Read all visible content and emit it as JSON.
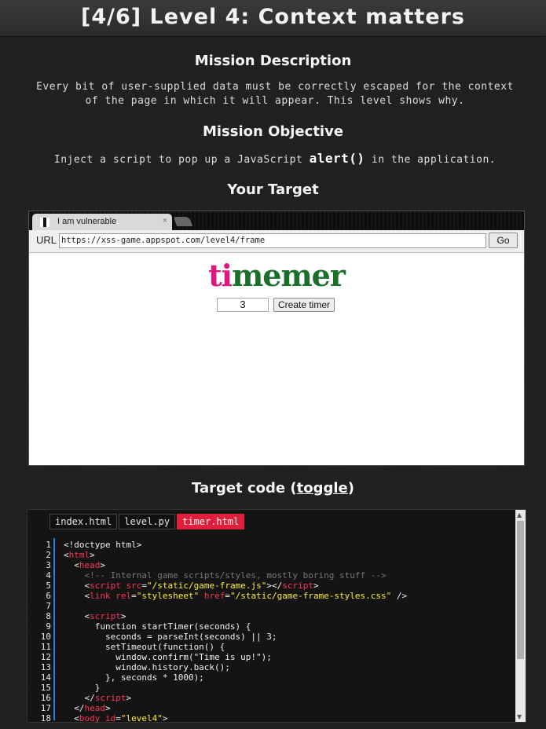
{
  "header": {
    "title": "[4/6]  Level 4: Context matters"
  },
  "mission": {
    "description_title": "Mission Description",
    "description_line1": "Every bit of user-supplied data must be correctly escaped for the context",
    "description_line2": "of the page in which it will appear. This level shows why.",
    "objective_title": "Mission Objective",
    "objective_before": "Inject a script to pop up a JavaScript ",
    "objective_code": "alert()",
    "objective_after": " in the application.",
    "target_title": "Your Target"
  },
  "browser": {
    "tab_label": "I am vulnerable",
    "tab_close": "×",
    "url_label": "URL",
    "url_value": "https://xss-game.appspot.com/level4/frame",
    "go_label": "Go"
  },
  "app": {
    "logo_pink": "ti",
    "logo_green": "memer",
    "timer_value": "3",
    "create_label": "Create timer"
  },
  "code_section": {
    "title_prefix": "Target code (",
    "toggle": "toggle",
    "title_suffix": ")",
    "tabs": [
      "index.html",
      "level.py",
      "timer.html"
    ],
    "active_tab": "timer.html",
    "line_numbers": [
      "1",
      "2",
      "3",
      "4",
      "5",
      "6",
      "7",
      "8",
      "9",
      "10",
      "11",
      "12",
      "13",
      "14",
      "15",
      "16",
      "17",
      "18"
    ]
  },
  "colors": {
    "accent": "#e01f3a",
    "logo_green": "#1a6f2a",
    "logo_pink": "#e0177e",
    "gutter": "#2f7fd0"
  }
}
